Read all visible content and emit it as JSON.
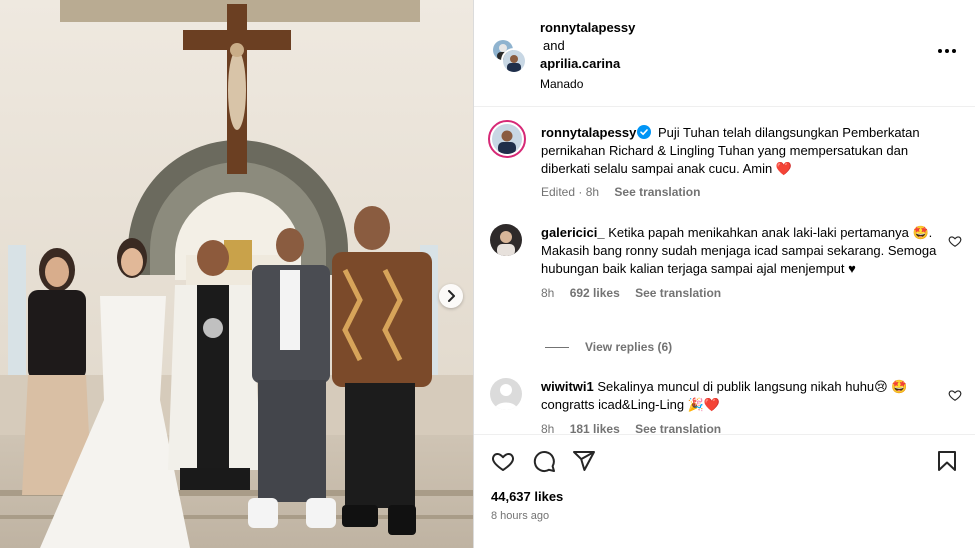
{
  "post": {
    "header": {
      "user1": "ronnytalapessy",
      "and_text": "and",
      "user2": "aprilia.carina",
      "location": "Manado"
    },
    "caption": {
      "username": "ronnytalapessy",
      "verified": true,
      "text": "Puji Tuhan telah dilangsungkan Pemberkatan pernikahan Richard & Lingling Tuhan yang mempersatukan dan diberkati selalu sampai anak cucu. Amin",
      "emoji": "❤️",
      "edited": "Edited · 8h",
      "see_translation": "See translation"
    },
    "comments": [
      {
        "username": "galericici_",
        "text": "Ketika papah menikahkan anak laki-laki pertamanya 🤩. Makasih bang ronny sudah menjaga icad sampai sekarang. Semoga hubungan baik kalian terjaga sampai ajal menjemput ♥",
        "time": "8h",
        "likes": "692 likes",
        "see_translation": "See translation",
        "view_replies": "View replies (6)"
      },
      {
        "username": "wiwitwi1",
        "text": "Sekalinya muncul di publik langsung nikah huhu😢 🤩 congratts icad&Ling-Ling 🎉❤️",
        "time": "8h",
        "likes": "181 likes",
        "see_translation": "See translation"
      }
    ],
    "likes": "44,637 likes",
    "time": "8 hours ago"
  },
  "icons": [
    "heart-icon",
    "comment-icon",
    "share-icon",
    "bookmark-icon",
    "more-icon",
    "next-arrow-icon",
    "verified-badge-icon"
  ],
  "colors": {
    "accent_blue": "#0095f6",
    "heart_red": "#ed4956",
    "muted": "#737373",
    "border": "#dbdbdb"
  }
}
